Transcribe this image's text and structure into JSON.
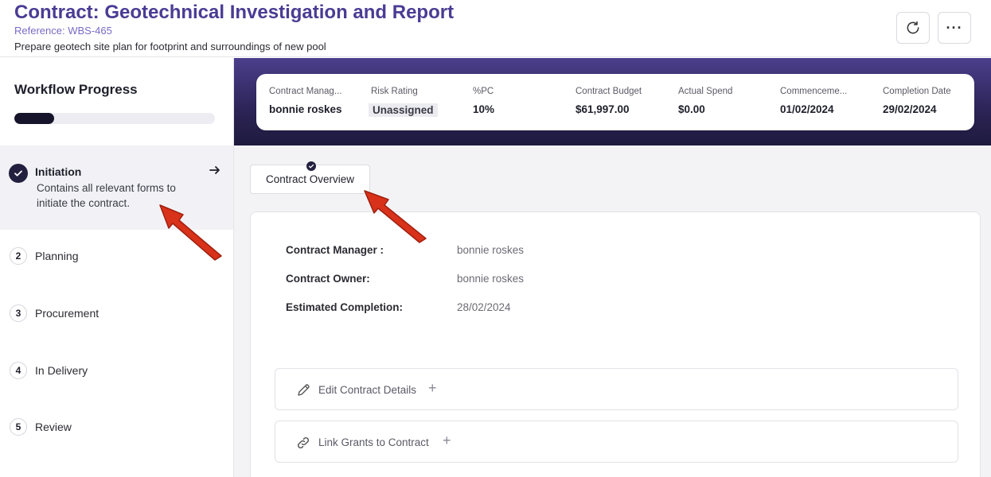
{
  "header": {
    "title": "Contract: Geotechnical Investigation and Report",
    "reference": "Reference: WBS-465",
    "description": "Prepare geotech site plan for footprint and surroundings of new pool",
    "more_label": "···"
  },
  "sidebar": {
    "title": "Workflow Progress",
    "progress": 0.2,
    "steps": [
      {
        "number": "1",
        "label": "Initiation",
        "description": "Contains all relevant forms to initiate the contract.",
        "status": "complete"
      },
      {
        "number": "2",
        "label": "Planning"
      },
      {
        "number": "3",
        "label": "Procurement"
      },
      {
        "number": "4",
        "label": "In Delivery"
      },
      {
        "number": "5",
        "label": "Review"
      }
    ]
  },
  "summary": {
    "contract_manager": {
      "label": "Contract Manag...",
      "value": "bonnie roskes"
    },
    "risk_rating": {
      "label": "Risk Rating",
      "value": "Unassigned"
    },
    "pc": {
      "label": "%PC",
      "value": "10%"
    },
    "contract_budget": {
      "label": "Contract Budget",
      "value": "$61,997.00"
    },
    "actual_spend": {
      "label": "Actual Spend",
      "value": "$0.00"
    },
    "commencement": {
      "label": "Commenceme...",
      "value": "01/02/2024"
    },
    "completion_date": {
      "label": "Completion Date",
      "value": "29/02/2024"
    }
  },
  "tabs": [
    {
      "label": "Contract Overview",
      "status": "complete"
    }
  ],
  "overview": {
    "fields": [
      {
        "label": "Contract Manager :",
        "value": "bonnie roskes"
      },
      {
        "label": "Contract Owner:",
        "value": "bonnie roskes"
      },
      {
        "label": "Estimated Completion:",
        "value": "28/02/2024"
      }
    ],
    "actions": [
      {
        "label": "Edit Contract Details",
        "icon": "pencil-icon"
      },
      {
        "label": "Link Grants to Contract",
        "icon": "link-icon"
      }
    ],
    "plus_label": "+"
  },
  "colors": {
    "brand": "#4a3c94",
    "dark": "#22203f",
    "arrow": "#d9321a"
  }
}
